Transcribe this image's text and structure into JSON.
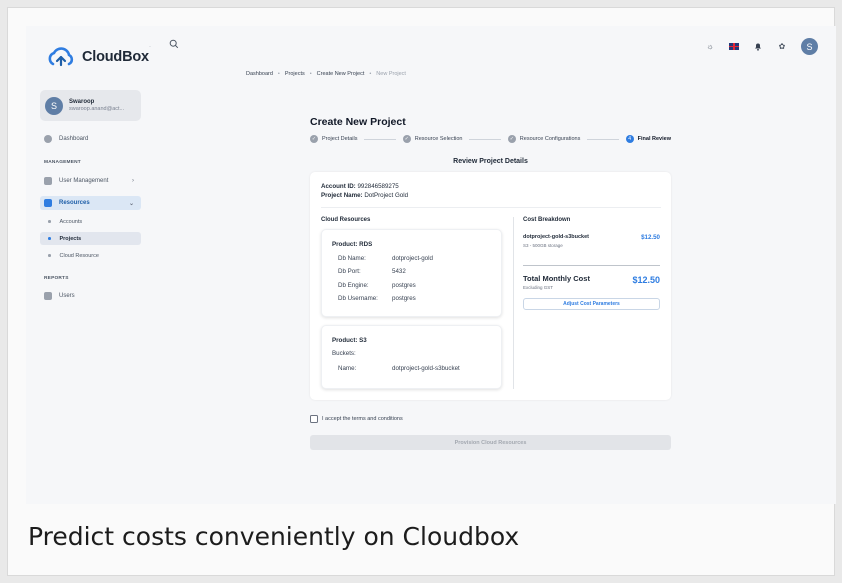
{
  "app": {
    "name": "CloudBox"
  },
  "user": {
    "initial": "S",
    "name": "Swaroop",
    "email": "swaroop.anand@act..."
  },
  "sidebar": {
    "dashboard": "Dashboard",
    "management_title": "MANAGEMENT",
    "user_management": "User Management",
    "resources": "Resources",
    "sub_items": [
      "Accounts",
      "Projects",
      "Cloud Resource"
    ],
    "reports_title": "REPORTS",
    "users": "Users"
  },
  "topbar": {
    "avatar_initial": "S"
  },
  "breadcrumb": [
    "Dashboard",
    "Projects",
    "Create New Project",
    "New Project"
  ],
  "page": {
    "title": "Create New Project"
  },
  "stepper": {
    "steps": [
      "Project Details",
      "Resource Selection",
      "Resource Configurations",
      "Final Review"
    ],
    "active_number": "4"
  },
  "review": {
    "title": "Review Project Details",
    "account_id_label": "Account ID:",
    "account_id": "992846589275",
    "project_name_label": "Project Name:",
    "project_name": "DotProject Gold",
    "cloud_resources_title": "Cloud Resources",
    "cost_breakdown_title": "Cost Breakdown"
  },
  "rds": {
    "title": "Product: RDS",
    "rows": [
      {
        "label": "Db Name:",
        "value": "dotproject-gold"
      },
      {
        "label": "Db Port:",
        "value": "5432"
      },
      {
        "label": "Db Engine:",
        "value": "postgres"
      },
      {
        "label": "Db Username:",
        "value": "postgres"
      }
    ]
  },
  "s3": {
    "title": "Product: S3",
    "buckets_label": "Buckets:",
    "name_label": "Name:",
    "name_value": "dotproject-gold-s3bucket"
  },
  "cost": {
    "item_name": "dotproject-gold-s3bucket",
    "item_sub": "S3 - 500GB storage",
    "item_amount": "$12.50",
    "total_label": "Total Monthly Cost",
    "total_sub": "Excluding GST",
    "total_amount": "$12.50",
    "adjust_label": "Adjust Cost Parameters"
  },
  "terms_label": "I accept the terms and conditions",
  "provision_label": "Provision Cloud Resources",
  "caption": "Predict costs conveniently on Cloudbox",
  "colors": {
    "accent": "#2f7de1",
    "avatar": "#5f7ea6"
  }
}
